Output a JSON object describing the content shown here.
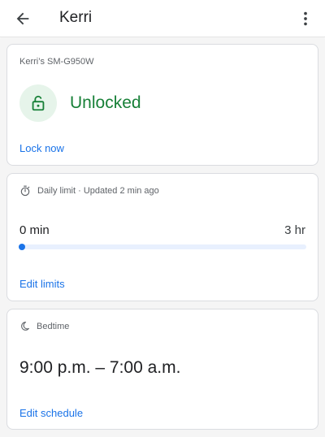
{
  "appbar": {
    "title": "Kerri",
    "back_icon": "arrow-back-icon",
    "more_icon": "more-vert-icon"
  },
  "device_card": {
    "device_name": "Kerri’s SM-G950W",
    "lock_icon": "unlocked-padlock-icon",
    "status": "Unlocked",
    "action": "Lock now"
  },
  "daily_limit_card": {
    "icon": "timer-icon",
    "header": "Daily limit · Updated 2 min ago",
    "used": "0 min",
    "limit": "3 hr",
    "progress_fraction": 0,
    "action": "Edit limits"
  },
  "bedtime_card": {
    "icon": "moon-icon",
    "header": "Bedtime",
    "schedule": "9:00 p.m. – 7:00 a.m.",
    "action": "Edit schedule"
  },
  "colors": {
    "accent": "#1a73e8",
    "unlocked_green": "#188038",
    "unlocked_bg": "#e6f4ea"
  }
}
